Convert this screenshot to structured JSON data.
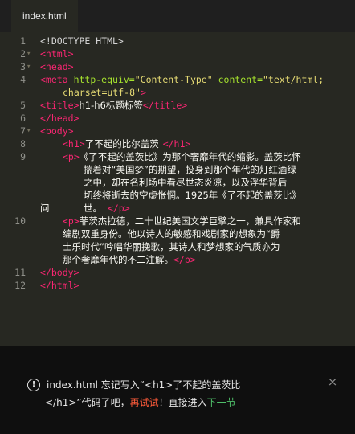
{
  "tab": {
    "label": "index.html"
  },
  "editor": {
    "line_numbers": [
      "1",
      "2",
      "3",
      "4",
      "5",
      "6",
      "7",
      "8",
      "9",
      "10",
      "11",
      "12"
    ],
    "code": {
      "l1": "<!DOCTYPE HTML>",
      "l2": "<html>",
      "l3": "<head>",
      "l4_tag_open": "<meta",
      "l4_attr1": "http-equiv=",
      "l4_val1": "\"Content-Type\"",
      "l4_attr2": "content=",
      "l4_val2a": "\"text/html;",
      "l4_val2b": "charset=utf-8\"",
      "l4_tag_close": ">",
      "l5_open": "<title>",
      "l5_text": "h1-h6标题标签",
      "l5_close": "</title>",
      "l6": "</head>",
      "l7": "<body>",
      "l8_open": "<h1>",
      "l8_text": "了不起的比尔盖茨",
      "l8_close": "</h1>",
      "l9_open": "<p>",
      "l9_w1": "《了不起的盖茨比》为那个奢靡年代的缩影。盖茨比怀",
      "l9_w2": "揣着对“美国梦”的期望，投身到那个年代的灯红酒绿",
      "l9_w3": "之中，却在名利场中看尽世态炎凉，以及浮华背后一",
      "l9_w4": "切终将逝去的空虚怅惘。1925年《了不起的盖茨比》",
      "l9_w5a": "问",
      "l9_w5b": "世。",
      "l9_close": "</p>",
      "l10_open": "<p>",
      "l10_w1": "菲茨杰拉德，二十世纪美国文学巨擘之一，兼具作家和",
      "l10_w2": "编剧双重身份。他以诗人的敏感和戏剧家的想象为“爵",
      "l10_w3": "士乐时代”吟唱华丽挽歌，其诗人和梦想家的气质亦为",
      "l10_w4": "那个奢靡年代的不二注解。",
      "l10_close": "</p>",
      "l11": "</body>",
      "l12": "</html>"
    }
  },
  "notification": {
    "icon": "info-circle-icon",
    "part1": "index.html 忘记写入“<h1>了不起的盖茨比",
    "part2": "</h1>”代码了吧，",
    "retry": "再试试",
    "part3": "！直接进入",
    "next": "下一节",
    "close_icon": "close-icon",
    "close_glyph": "×"
  },
  "colors": {
    "tag": "#f92672",
    "attribute": "#a6e22e",
    "string": "#e6db74",
    "retry": "#ff5b3a",
    "next": "#4fc06a"
  }
}
